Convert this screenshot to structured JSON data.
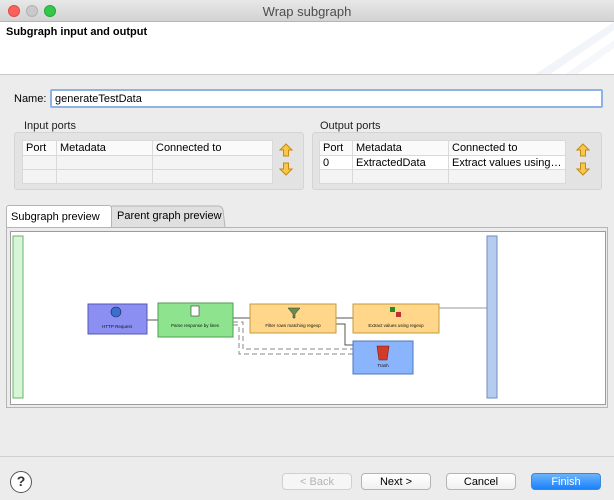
{
  "window": {
    "title": "Wrap subgraph"
  },
  "banner": {
    "title": "Subgraph input and output"
  },
  "name_field": {
    "label": "Name:",
    "value": "generateTestData"
  },
  "input_ports": {
    "title": "Input ports",
    "columns": [
      "Port",
      "Metadata",
      "Connected to"
    ],
    "rows": []
  },
  "output_ports": {
    "title": "Output ports",
    "columns": [
      "Port",
      "Metadata",
      "Connected to"
    ],
    "rows": [
      {
        "port": "0",
        "metadata": "ExtractedData",
        "connected_to": "Extract values using r..."
      }
    ]
  },
  "tabs": [
    {
      "label": "Subgraph preview",
      "active": true
    },
    {
      "label": "Parent graph preview",
      "active": false
    }
  ],
  "preview": {
    "components": [
      {
        "id": "http",
        "label": "HTTP Request",
        "color": "#8b8ff2",
        "icon": "globe-icon"
      },
      {
        "id": "parse",
        "label": "Parse response by lines",
        "color": "#8ee48e",
        "icon": "document-icon"
      },
      {
        "id": "filter",
        "label": "Filter rows matching regexp",
        "color": "#ffd68a",
        "icon": "funnel-icon"
      },
      {
        "id": "extract",
        "label": "Extract values using regexp",
        "color": "#ffd68a",
        "icon": "transform-icon"
      },
      {
        "id": "trash",
        "label": "Trash",
        "color": "#8ab4fb",
        "icon": "trash-icon"
      }
    ]
  },
  "buttons": {
    "help": "?",
    "back": "< Back",
    "next": "Next >",
    "cancel": "Cancel",
    "finish": "Finish"
  },
  "colors": {
    "accent": "#1a82fb",
    "input_focus": "#8db2e3"
  }
}
